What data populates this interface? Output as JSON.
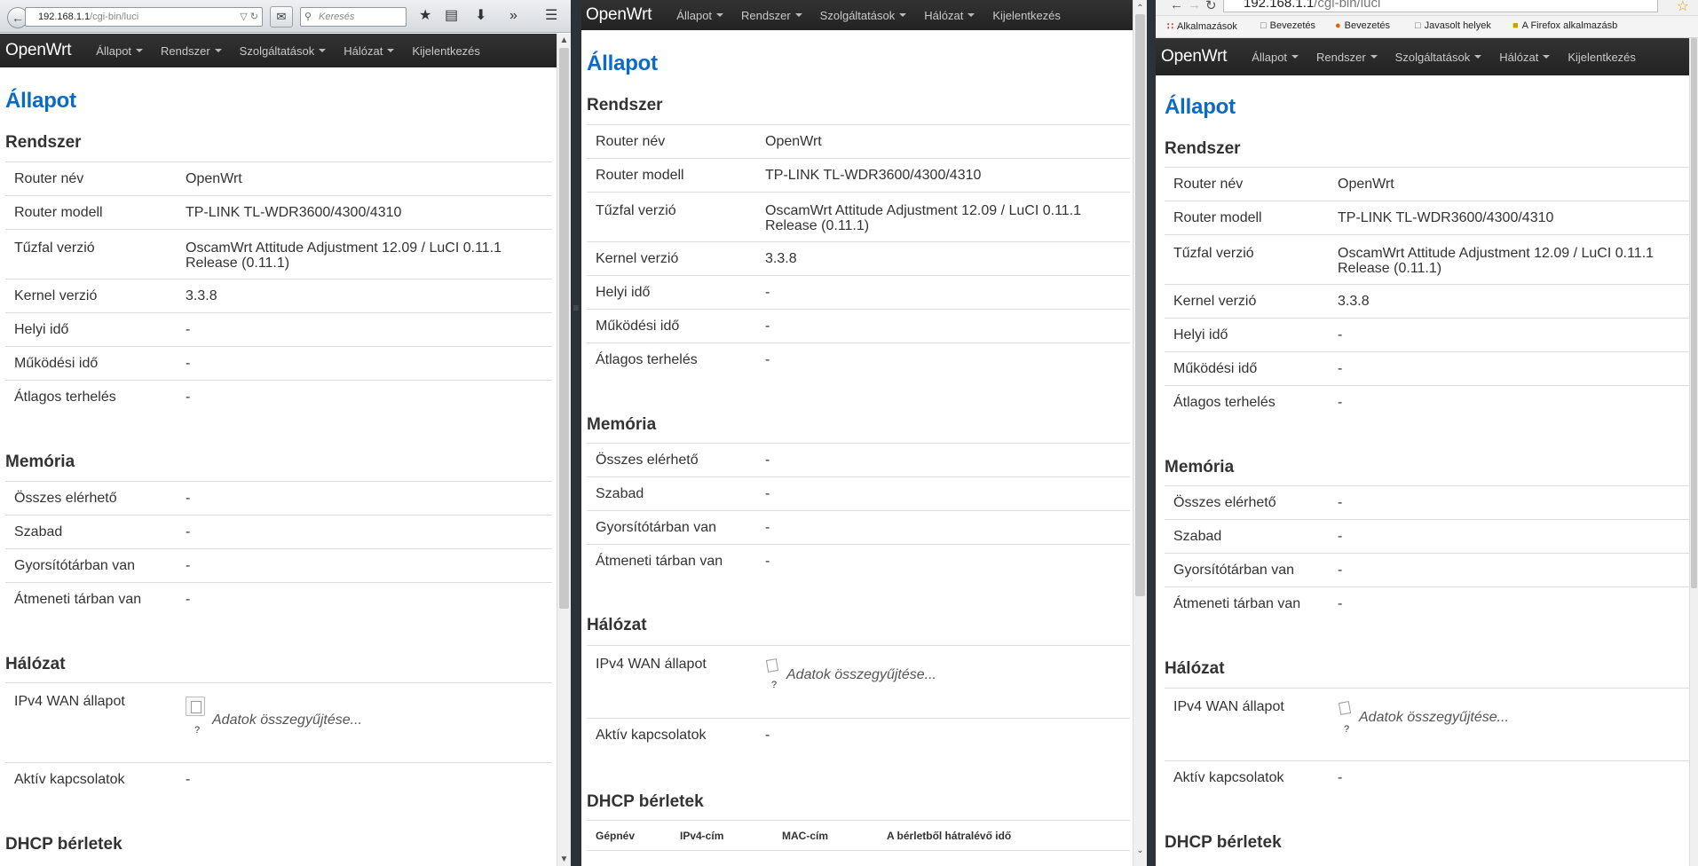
{
  "browser_a": {
    "url_host": "192.168.1.1",
    "url_path": "/cgi-bin/luci",
    "search_placeholder": "Keresés"
  },
  "browser_c": {
    "url_host": "192.168.1.1",
    "url_path": "/cgi-bin/luci",
    "bookmarks": [
      "Alkalmazások",
      "Bevezetés",
      "Bevezetés",
      "Javasolt helyek",
      "A Firefox alkalmazásb"
    ]
  },
  "nav": {
    "brand": "OpenWrt",
    "menu": [
      "Állapot",
      "Rendszer",
      "Szolgáltatások",
      "Hálózat",
      "Kijelentkezés"
    ]
  },
  "page": {
    "title": "Állapot",
    "system": {
      "title": "Rendszer",
      "rows": [
        {
          "label": "Router név",
          "value": "OpenWrt"
        },
        {
          "label": "Router modell",
          "value": "TP-LINK TL-WDR3600/4300/4310"
        },
        {
          "label": "Tűzfal verzió",
          "value": "OscamWrt Attitude Adjustment 12.09 / LuCI 0.11.1 Release (0.11.1)"
        },
        {
          "label": "Kernel verzió",
          "value": "3.3.8"
        },
        {
          "label": "Helyi idő",
          "value": "-"
        },
        {
          "label": "Működési idő",
          "value": "-"
        },
        {
          "label": "Átlagos terhelés",
          "value": "-"
        }
      ]
    },
    "memory": {
      "title": "Memória",
      "rows": [
        {
          "label": "Összes elérhető",
          "value": "-"
        },
        {
          "label": "Szabad",
          "value": "-"
        },
        {
          "label": "Gyorsítótárban van",
          "value": "-"
        },
        {
          "label": "Átmeneti tárban van",
          "value": "-"
        }
      ]
    },
    "network": {
      "title": "Hálózat",
      "wan_label": "IPv4 WAN állapot",
      "wan_collecting": "Adatok összegyűjtése...",
      "wan_question": "?",
      "active_label": "Aktív kapcsolatok",
      "active_value": "-"
    },
    "dhcp": {
      "title": "DHCP bérletek",
      "columns": [
        "Gépnév",
        "IPv4-cím",
        "MAC-cím",
        "A bérletből hátralévő idő"
      ]
    }
  }
}
